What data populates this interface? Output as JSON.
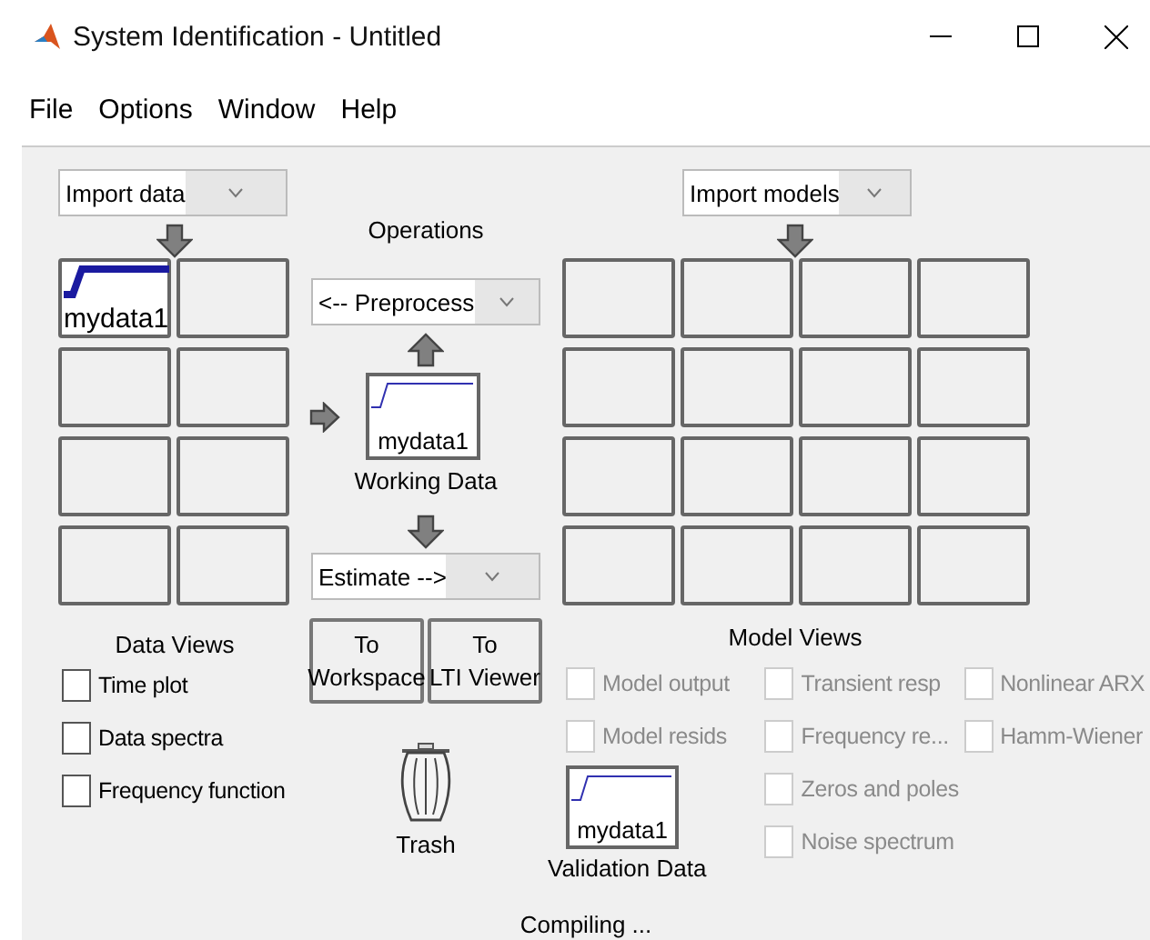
{
  "window": {
    "title": "System Identification - Untitled"
  },
  "menu": [
    "File",
    "Options",
    "Window",
    "Help"
  ],
  "data_panel": {
    "import": {
      "value": "Import data"
    },
    "slots": [
      {
        "kind": "data",
        "label": "mydata1"
      },
      {
        "kind": "empty"
      },
      {
        "kind": "empty"
      },
      {
        "kind": "empty"
      },
      {
        "kind": "empty"
      },
      {
        "kind": "empty"
      },
      {
        "kind": "empty"
      },
      {
        "kind": "empty"
      }
    ],
    "views_title": "Data Views",
    "views": [
      {
        "label": "Time plot",
        "checked": false,
        "disabled": false
      },
      {
        "label": "Data spectra",
        "checked": false,
        "disabled": false
      },
      {
        "label": "Frequency function",
        "checked": false,
        "disabled": false
      }
    ]
  },
  "operations": {
    "title": "Operations",
    "preprocess": {
      "value": "<-- Preprocess"
    },
    "working_data": {
      "label": "mydata1",
      "caption": "Working Data"
    },
    "estimate": {
      "value": "Estimate -->"
    },
    "buttons": [
      [
        "To",
        "Workspace"
      ],
      [
        "To",
        "LTI Viewer"
      ]
    ],
    "trash": "Trash"
  },
  "model_panel": {
    "import": {
      "value": "Import models"
    },
    "slots": [
      {
        "kind": "empty"
      },
      {
        "kind": "empty"
      },
      {
        "kind": "empty"
      },
      {
        "kind": "empty"
      },
      {
        "kind": "empty"
      },
      {
        "kind": "empty"
      },
      {
        "kind": "empty"
      },
      {
        "kind": "empty"
      },
      {
        "kind": "empty"
      },
      {
        "kind": "empty"
      },
      {
        "kind": "empty"
      },
      {
        "kind": "empty"
      },
      {
        "kind": "empty"
      },
      {
        "kind": "empty"
      },
      {
        "kind": "empty"
      },
      {
        "kind": "empty"
      }
    ],
    "views_title": "Model Views",
    "view_columns": [
      [
        {
          "label": "Model output",
          "checked": false,
          "disabled": true
        },
        {
          "label": "Model resids",
          "checked": false,
          "disabled": true
        }
      ],
      [
        {
          "label": "Transient resp",
          "checked": false,
          "disabled": true
        },
        {
          "label": "Frequency re...",
          "checked": false,
          "disabled": true
        },
        {
          "label": "Zeros and poles",
          "checked": false,
          "disabled": true
        },
        {
          "label": "Noise spectrum",
          "checked": false,
          "disabled": true
        }
      ],
      [
        {
          "label": "Nonlinear ARX",
          "checked": false,
          "disabled": true
        },
        {
          "label": "Hamm-Wiener",
          "checked": false,
          "disabled": true
        }
      ]
    ],
    "validation_data": {
      "label": "mydata1",
      "caption": "Validation Data"
    }
  },
  "status": "Compiling ..."
}
